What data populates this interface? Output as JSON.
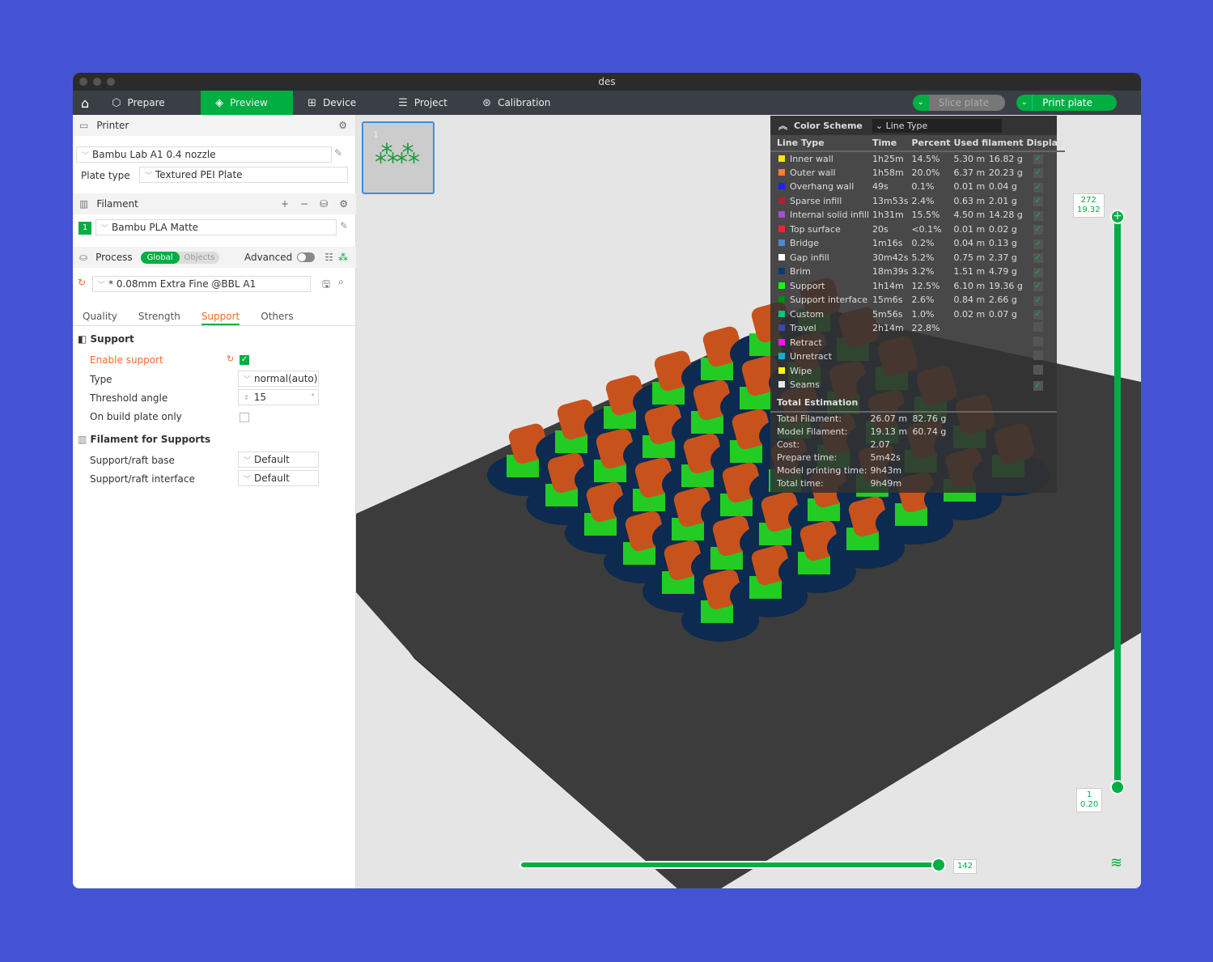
{
  "window": {
    "title": "des"
  },
  "nav": {
    "tabs": [
      {
        "label": "Prepare",
        "icon": "cube-icon"
      },
      {
        "label": "Preview",
        "icon": "layers-icon",
        "active": true
      },
      {
        "label": "Device",
        "icon": "device-icon"
      },
      {
        "label": "Project",
        "icon": "project-icon"
      },
      {
        "label": "Calibration",
        "icon": "calibration-icon"
      }
    ],
    "slice": "Slice plate",
    "print": "Print plate"
  },
  "printer": {
    "title": "Printer",
    "model": "Bambu Lab A1 0.4 nozzle",
    "plate_label": "Plate type",
    "plate": "Textured PEI Plate"
  },
  "filament": {
    "title": "Filament",
    "slot": "1",
    "name": "Bambu PLA Matte"
  },
  "process": {
    "title": "Process",
    "global": "Global",
    "objects": "Objects",
    "advanced": "Advanced",
    "preset": "* 0.08mm Extra Fine @BBL A1",
    "tabs": [
      "Quality",
      "Strength",
      "Support",
      "Others"
    ],
    "active_tab": "Support"
  },
  "support": {
    "title": "Support",
    "enable": "Enable support",
    "enable_checked": true,
    "type_label": "Type",
    "type": "normal(auto)",
    "threshold_label": "Threshold angle",
    "threshold": "15",
    "buildplate_label": "On build plate only",
    "buildplate_checked": false
  },
  "filsup": {
    "title": "Filament for Supports",
    "base_label": "Support/raft base",
    "base": "Default",
    "iface_label": "Support/raft interface",
    "iface": "Default"
  },
  "legend": {
    "title": "Color Scheme",
    "scheme": "Line Type",
    "headers": [
      "Line Type",
      "Time",
      "Percent",
      "Used filament",
      "Display"
    ],
    "rows": [
      {
        "name": "Inner wall",
        "color": "#ffe600",
        "time": "1h25m",
        "pct": "14.5%",
        "m": "5.30 m",
        "g": "16.82 g",
        "on": true
      },
      {
        "name": "Outer wall",
        "color": "#ff7d38",
        "time": "1h58m",
        "pct": "20.0%",
        "m": "6.37 m",
        "g": "20.23 g",
        "on": true
      },
      {
        "name": "Overhang wall",
        "color": "#1f1fff",
        "time": "49s",
        "pct": "0.1%",
        "m": "0.01 m",
        "g": "0.04 g",
        "on": true
      },
      {
        "name": "Sparse infill",
        "color": "#b0202a",
        "time": "13m53s",
        "pct": "2.4%",
        "m": "0.63 m",
        "g": "2.01 g",
        "on": true
      },
      {
        "name": "Internal solid infill",
        "color": "#a050d0",
        "time": "1h31m",
        "pct": "15.5%",
        "m": "4.50 m",
        "g": "14.28 g",
        "on": true
      },
      {
        "name": "Top surface",
        "color": "#ff2030",
        "time": "20s",
        "pct": "<0.1%",
        "m": "0.01 m",
        "g": "0.02 g",
        "on": true
      },
      {
        "name": "Bridge",
        "color": "#4a8ad0",
        "time": "1m16s",
        "pct": "0.2%",
        "m": "0.04 m",
        "g": "0.13 g",
        "on": true
      },
      {
        "name": "Gap infill",
        "color": "#ffffff",
        "time": "30m42s",
        "pct": "5.2%",
        "m": "0.75 m",
        "g": "2.37 g",
        "on": true
      },
      {
        "name": "Brim",
        "color": "#0a3a70",
        "time": "18m39s",
        "pct": "3.2%",
        "m": "1.51 m",
        "g": "4.79 g",
        "on": true
      },
      {
        "name": "Support",
        "color": "#10ff10",
        "time": "1h14m",
        "pct": "12.5%",
        "m": "6.10 m",
        "g": "19.36 g",
        "on": true
      },
      {
        "name": "Support interface",
        "color": "#008a10",
        "time": "15m6s",
        "pct": "2.6%",
        "m": "0.84 m",
        "g": "2.66 g",
        "on": true
      },
      {
        "name": "Custom",
        "color": "#10c080",
        "time": "5m56s",
        "pct": "1.0%",
        "m": "0.02 m",
        "g": "0.07 g",
        "on": true
      },
      {
        "name": "Travel",
        "color": "#3848b0",
        "time": "2h14m",
        "pct": "22.8%",
        "m": "",
        "g": "",
        "on": false
      },
      {
        "name": "Retract",
        "color": "#ff10ff",
        "time": "",
        "pct": "",
        "m": "",
        "g": "",
        "on": false
      },
      {
        "name": "Unretract",
        "color": "#10b0d0",
        "time": "",
        "pct": "",
        "m": "",
        "g": "",
        "on": false
      },
      {
        "name": "Wipe",
        "color": "#ffff00",
        "time": "",
        "pct": "",
        "m": "",
        "g": "",
        "on": false
      },
      {
        "name": "Seams",
        "color": "#e8e8e8",
        "time": "",
        "pct": "",
        "m": "",
        "g": "",
        "on": true
      }
    ],
    "total_title": "Total Estimation",
    "totals": [
      [
        "Total Filament:",
        "26.07 m",
        "82.76 g"
      ],
      [
        "Model Filament:",
        "19.13 m",
        "60.74 g"
      ],
      [
        "Cost:",
        "2.07",
        ""
      ],
      [
        "Prepare time:",
        "5m42s",
        ""
      ],
      [
        "Model printing time:",
        "9h43m",
        ""
      ],
      [
        "Total time:",
        "9h49m",
        ""
      ]
    ]
  },
  "layer_slider": {
    "top_layer": "272",
    "top_height": "19.32",
    "bottom_layer": "1",
    "bottom_height": "0.20"
  },
  "move_slider": {
    "value": "142"
  },
  "plate": {
    "thumb_number": "1",
    "plate_number": "01"
  },
  "accent": "#00ae42"
}
